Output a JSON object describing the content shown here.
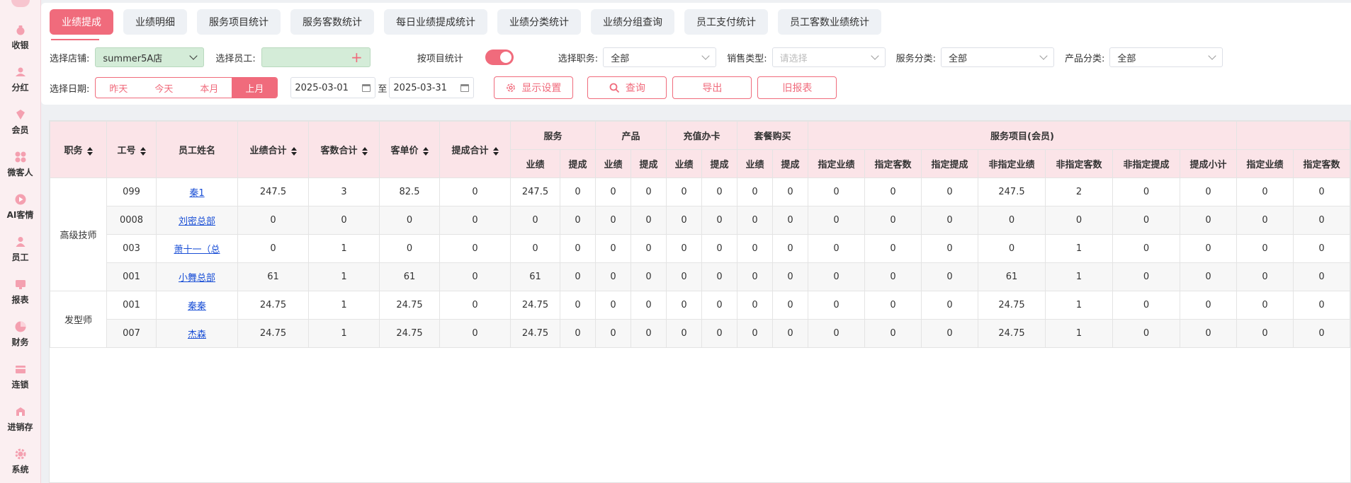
{
  "sidebar": {
    "items": [
      {
        "label": "收银",
        "icon": "cashier-icon"
      },
      {
        "label": "分红",
        "icon": "dividend-icon"
      },
      {
        "label": "会员",
        "icon": "member-icon"
      },
      {
        "label": "微客人",
        "icon": "micro-guest-icon"
      },
      {
        "label": "AI客情",
        "icon": "ai-play-icon"
      },
      {
        "label": "员工",
        "icon": "employee-icon"
      },
      {
        "label": "报表",
        "icon": "report-icon"
      },
      {
        "label": "财务",
        "icon": "finance-icon"
      },
      {
        "label": "连锁",
        "icon": "chain-store-icon"
      },
      {
        "label": "进销存",
        "icon": "inventory-icon"
      },
      {
        "label": "系统",
        "icon": "settings-gear-icon"
      }
    ]
  },
  "tabs": [
    "业绩提成",
    "业绩明细",
    "服务项目统计",
    "服务客数统计",
    "每日业绩提成统计",
    "业绩分类统计",
    "业绩分组查询",
    "员工支付统计",
    "员工客数业绩统计"
  ],
  "filters": {
    "store_label": "选择店铺:",
    "store_value": "summer5A店",
    "employee_label": "选择员工:",
    "by_item_label": "按项目统计",
    "position_label": "选择职务:",
    "position_value": "全部",
    "sale_type_label": "销售类型:",
    "sale_type_placeholder": "请选择",
    "service_cat_label": "服务分类:",
    "service_cat_value": "全部",
    "product_cat_label": "产品分类:",
    "product_cat_value": "全部",
    "date_label": "选择日期:",
    "quick_dates": [
      "昨天",
      "今天",
      "本月",
      "上月"
    ],
    "date_from": "2025-03-01",
    "date_sep": "至",
    "date_to": "2025-03-31",
    "display_settings": "显示设置",
    "query": "查询",
    "export": "导出",
    "old_report": "旧报表"
  },
  "table": {
    "h_role": "职务",
    "h_id": "工号",
    "h_name": "员工姓名",
    "h_total_perf": "业绩合计",
    "h_total_guests": "客数合计",
    "h_avg_price": "客单价",
    "h_total_comm": "提成合计",
    "h_service": "服务",
    "h_product": "产品",
    "h_recharge": "充值办卡",
    "h_package": "套餐购买",
    "h_service_items": "服务项目(会员)",
    "h_perf": "业绩",
    "h_comm": "提成",
    "h_sub": [
      "指定业绩",
      "指定客数",
      "指定提成",
      "非指定业绩",
      "非指定客数",
      "非指定提成",
      "提成小计",
      "指定业绩",
      "指定客数"
    ],
    "rows": [
      {
        "role": "高级技师",
        "id": "099",
        "name": "秦1",
        "c": [
          "247.5",
          "3",
          "82.5",
          "0",
          "247.5",
          "0",
          "0",
          "0",
          "0",
          "0",
          "0",
          "0",
          "0",
          "0",
          "0",
          "247.5",
          "2",
          "0",
          "0",
          "0",
          "0"
        ]
      },
      {
        "role": "",
        "id": "0008",
        "name": "刘密总部",
        "c": [
          "0",
          "0",
          "0",
          "0",
          "0",
          "0",
          "0",
          "0",
          "0",
          "0",
          "0",
          "0",
          "0",
          "0",
          "0",
          "0",
          "0",
          "0",
          "0",
          "0",
          "0"
        ]
      },
      {
        "role": "",
        "id": "003",
        "name": "萧十一（总",
        "c": [
          "0",
          "1",
          "0",
          "0",
          "0",
          "0",
          "0",
          "0",
          "0",
          "0",
          "0",
          "0",
          "0",
          "0",
          "0",
          "0",
          "1",
          "0",
          "0",
          "0",
          "0"
        ]
      },
      {
        "role": "",
        "id": "001",
        "name": "小舞总部",
        "c": [
          "61",
          "1",
          "61",
          "0",
          "61",
          "0",
          "0",
          "0",
          "0",
          "0",
          "0",
          "0",
          "0",
          "0",
          "0",
          "61",
          "1",
          "0",
          "0",
          "0",
          "0"
        ]
      },
      {
        "role": "发型师",
        "id": "001",
        "name": "秦秦",
        "c": [
          "24.75",
          "1",
          "24.75",
          "0",
          "24.75",
          "0",
          "0",
          "0",
          "0",
          "0",
          "0",
          "0",
          "0",
          "0",
          "0",
          "24.75",
          "1",
          "0",
          "0",
          "0",
          "0"
        ]
      },
      {
        "role": "",
        "id": "007",
        "name": "杰森",
        "c": [
          "24.75",
          "1",
          "24.75",
          "0",
          "24.75",
          "0",
          "0",
          "0",
          "0",
          "0",
          "0",
          "0",
          "0",
          "0",
          "0",
          "24.75",
          "1",
          "0",
          "0",
          "0",
          "0"
        ]
      }
    ]
  }
}
